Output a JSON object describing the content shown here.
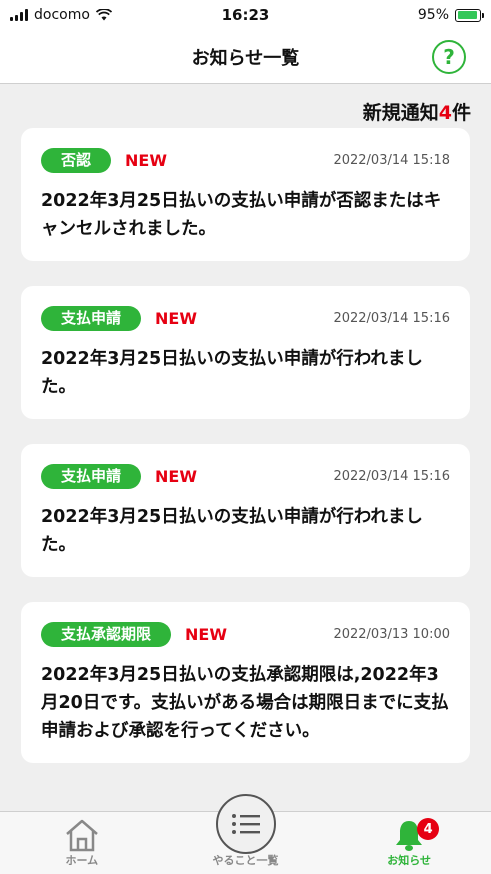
{
  "status_bar": {
    "carrier": "docomo",
    "time": "16:23",
    "battery_percent": "95%",
    "battery_level": 0.95
  },
  "header": {
    "title": "お知らせ一覧",
    "help_label": "?"
  },
  "summary": {
    "prefix": "新規通知",
    "count": "4",
    "suffix": "件"
  },
  "notifications": [
    {
      "badge": "否認",
      "new_label": "NEW",
      "time": "2022/03/14 15:18",
      "message": "2022年3月25日払いの支払い申請が否認またはキャンセルされました。"
    },
    {
      "badge": "支払申請",
      "new_label": "NEW",
      "time": "2022/03/14 15:16",
      "message": "2022年3月25日払いの支払い申請が行われました。"
    },
    {
      "badge": "支払申請",
      "new_label": "NEW",
      "time": "2022/03/14 15:16",
      "message": "2022年3月25日払いの支払い申請が行われました。"
    },
    {
      "badge": "支払承認期限",
      "new_label": "NEW",
      "time": "2022/03/13 10:00",
      "message": "2022年3月25日払いの支払承認期限は,2022年3月20日です。支払いがある場合は期限日までに支払申請および承認を行ってください。"
    }
  ],
  "tabbar": {
    "home": "ホーム",
    "todo": "やること一覧",
    "notices": "お知らせ",
    "notices_badge": "4"
  },
  "colors": {
    "accent_green": "#2fb43a",
    "new_red": "#e60012"
  }
}
